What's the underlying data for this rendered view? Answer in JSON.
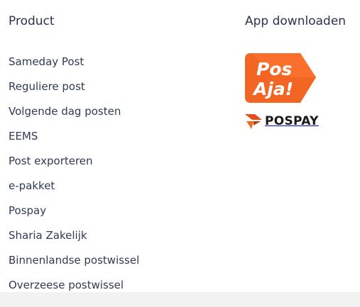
{
  "product": {
    "heading": "Product",
    "links": [
      "Sameday Post",
      "Reguliere post",
      "Volgende dag posten",
      "EEMS",
      "Post exporteren",
      "e-pakket",
      "Pospay",
      "Sharia Zakelijk",
      "Binnenlandse postwissel",
      "Overzeese postwissel"
    ]
  },
  "apps": {
    "heading": "App downloaden",
    "posaja": {
      "line1": "Pos",
      "line2": "Aja!",
      "icon": "posaja-logo",
      "color": "#f26522"
    },
    "pospay": {
      "label": "POSPAY",
      "icon": "pospay-logo",
      "color": "#f26522"
    }
  }
}
